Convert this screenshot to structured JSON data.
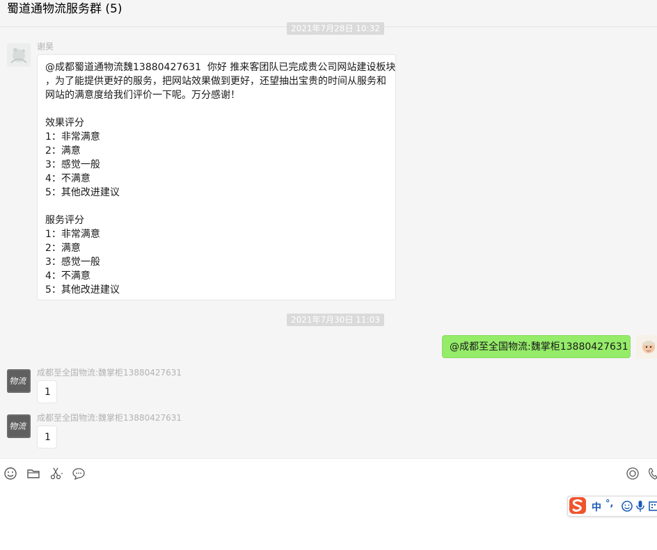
{
  "header": {
    "title": "蜀道通物流服务群 (5)"
  },
  "timestamps": [
    "2021年7月28日 10:32",
    "2021年7月30日 11:03"
  ],
  "messages": [
    {
      "sender": "谢昊",
      "lines": [
        "@成都蜀道通物流魏13880427631  你好 推来客团队已完成贵公司网站建设板块",
        "，为了能提供更好的服务，把网站效果做到更好，还望抽出宝贵的时间从服务和",
        "网站的满意度给我们评价一下呢。万分感谢！",
        "",
        "效果评分",
        "1：非常满意",
        "2：满意",
        "3：感觉一般",
        "4：不满意",
        "5：其他改进建议",
        "",
        "服务评分",
        "1：非常满意",
        "2：满意",
        "3：感觉一般",
        "4：不满意",
        "5：其他改进建议"
      ]
    },
    {
      "sender": "self",
      "text": "@成都至全国物流:魏掌柜13880427631"
    },
    {
      "sender": "成都至全国物流:魏掌柜13880427631",
      "text": "1"
    },
    {
      "sender": "成都至全国物流:魏掌柜13880427631",
      "text": "1"
    }
  ],
  "avatars": {
    "logo_text": "物流"
  },
  "toolbar": {
    "icons": [
      "emoji-icon",
      "folder-icon",
      "scissors-icon",
      "chat-bubble-icon",
      "video-call-icon",
      "phone-icon"
    ]
  },
  "ime": {
    "lang": "中",
    "punct": "°,"
  },
  "colors": {
    "self_bubble": "#95ec69",
    "timestamp_bg": "#dadada",
    "sougou": "#f0542d"
  }
}
